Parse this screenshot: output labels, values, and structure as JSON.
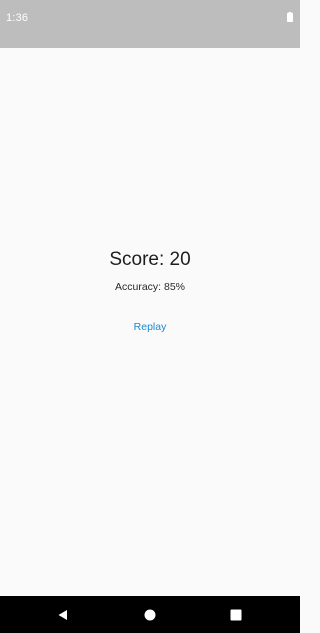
{
  "status_bar": {
    "time": "1:36",
    "battery_icon": "battery-full-icon",
    "background": "#bdbdbd"
  },
  "result": {
    "score_text": "Score: 20",
    "accuracy_text": "Accuracy: 85%",
    "replay_label": "Replay",
    "accent_color": "#1e88d0"
  },
  "nav_bar": {
    "back_icon": "back-triangle-icon",
    "home_icon": "home-circle-icon",
    "recents_icon": "recents-square-icon",
    "background": "#000000"
  }
}
